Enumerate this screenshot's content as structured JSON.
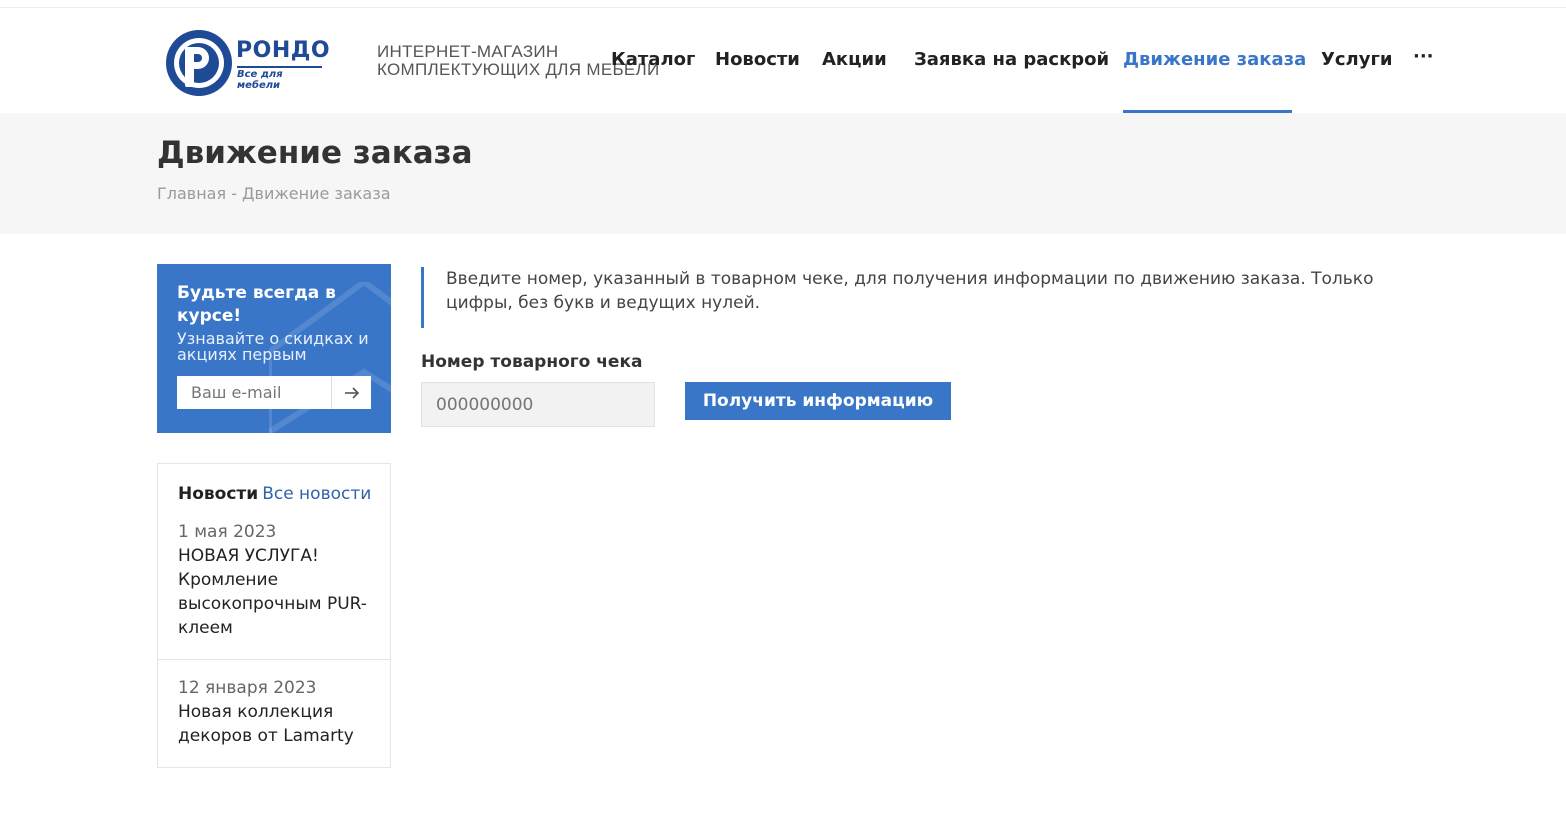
{
  "logo": {
    "name": "РОНДО",
    "slogan": "Все для мебели"
  },
  "tagline": {
    "line1": "ИНТЕРНЕТ-МАГАЗИН",
    "line2": "КОМПЛЕКТУЮЩИХ ДЛЯ МЕБЕЛИ"
  },
  "nav": {
    "items": [
      {
        "label": "Каталог"
      },
      {
        "label": "Новости"
      },
      {
        "label": "Акции"
      },
      {
        "label": "Заявка на раскрой"
      },
      {
        "label": "Движение заказа",
        "active": true
      },
      {
        "label": "Услуги"
      }
    ],
    "more": "···"
  },
  "page": {
    "title": "Движение заказа",
    "breadcrumb": "Главная - Движение заказа"
  },
  "subscribe": {
    "title": "Будьте всегда в курсе!",
    "text": "Узнавайте о скидках и акциях первым",
    "placeholder": "Ваш e-mail",
    "submit_icon": "arrow-right-icon"
  },
  "news": {
    "heading": "Новости",
    "all_link": "Все новости",
    "items": [
      {
        "date": "1 мая 2023",
        "title": "НОВАЯ УСЛУГА! Кромление высокопрочным PUR-клеем"
      },
      {
        "date": "12 января 2023",
        "title": "Новая коллекция декоров от Lamarty"
      }
    ]
  },
  "order": {
    "info": "Введите номер, указанный в товарном чеке, для получения информации по движению заказа. Только цифры, без букв и ведущих нулей.",
    "field_label": "Номер товарного чека",
    "placeholder": "000000000",
    "button": "Получить информацию"
  },
  "colors": {
    "accent": "#3a76c8",
    "brand": "#1e4a96",
    "link": "#2f62a8",
    "band": "#f6f6f6"
  }
}
